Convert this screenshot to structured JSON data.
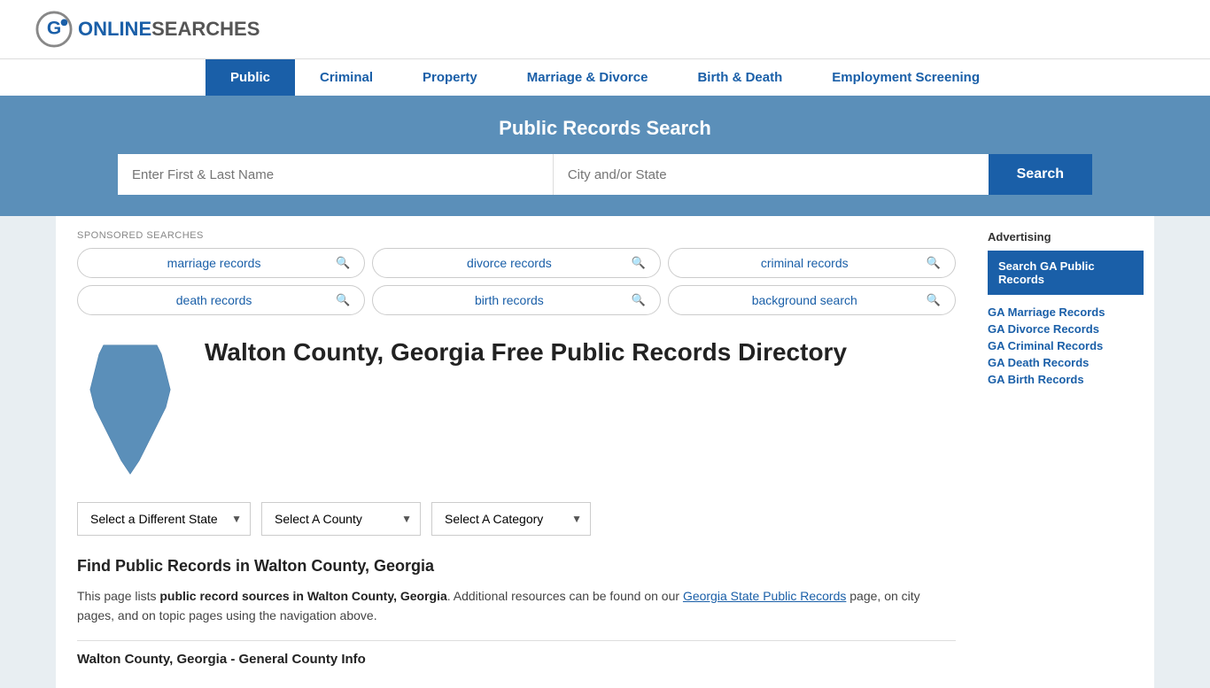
{
  "header": {
    "logo_text_part1": "ONLINE",
    "logo_text_part2": "SEARCHES",
    "logo_circle_color": "#888"
  },
  "nav": {
    "items": [
      {
        "label": "Public",
        "active": true
      },
      {
        "label": "Criminal",
        "active": false
      },
      {
        "label": "Property",
        "active": false
      },
      {
        "label": "Marriage & Divorce",
        "active": false
      },
      {
        "label": "Birth & Death",
        "active": false
      },
      {
        "label": "Employment Screening",
        "active": false
      }
    ]
  },
  "search_banner": {
    "title": "Public Records Search",
    "name_placeholder": "Enter First & Last Name",
    "location_placeholder": "City and/or State",
    "button_label": "Search"
  },
  "sponsored": {
    "label": "SPONSORED SEARCHES",
    "items": [
      {
        "text": "marriage records"
      },
      {
        "text": "divorce records"
      },
      {
        "text": "criminal records"
      },
      {
        "text": "death records"
      },
      {
        "text": "birth records"
      },
      {
        "text": "background search"
      }
    ]
  },
  "page": {
    "title": "Walton County, Georgia Free Public Records Directory",
    "dropdowns": {
      "state_label": "Select a Different State",
      "county_label": "Select A County",
      "category_label": "Select A Category"
    },
    "find_heading": "Find Public Records in Walton County, Georgia",
    "description_part1": "This page lists ",
    "description_bold": "public record sources in Walton County, Georgia",
    "description_part2": ". Additional resources can be found on our ",
    "description_link_text": "Georgia State Public Records",
    "description_part3": " page, on city pages, and on topic pages using the navigation above.",
    "section_subtitle": "Walton County, Georgia - General County Info"
  },
  "sidebar": {
    "ad_label": "Advertising",
    "ad_box_text": "Search GA Public Records",
    "links": [
      {
        "text": "GA Marriage Records"
      },
      {
        "text": "GA Divorce Records"
      },
      {
        "text": "GA Criminal Records"
      },
      {
        "text": "GA Death Records"
      },
      {
        "text": "GA Birth Records"
      }
    ]
  }
}
